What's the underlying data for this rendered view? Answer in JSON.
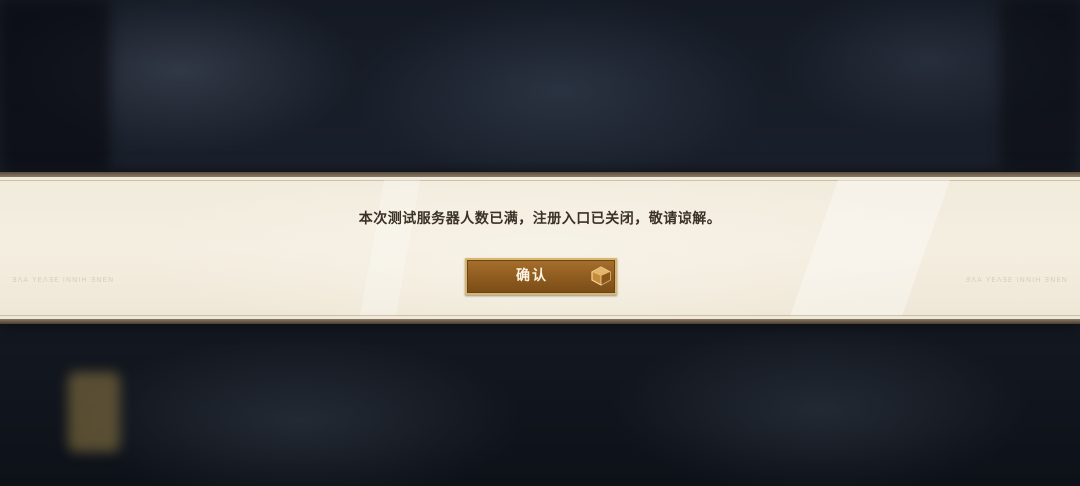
{
  "dialog": {
    "message": "本次测试服务器人数已满，注册入口已关闭，敬请谅解。",
    "confirm_label": "确认"
  },
  "banner": {
    "side_text_left": "ƎΛΑ ΥΕΛƎΕ ΙΝΝΙΗ ƎΝΕΝ",
    "side_text_right": "ƎΛΑ ΥΕΛƎΕ ΙΝΝΙΗ ƎΝΕΝ"
  },
  "colors": {
    "banner_bg": "#f2ecdf",
    "banner_edge": "#5a4c3d",
    "button_fill": "#9a6526",
    "button_border": "#d9b56e",
    "message_text": "#3b3126"
  },
  "icons": {
    "confirm_gem": "cube-gem-icon"
  }
}
